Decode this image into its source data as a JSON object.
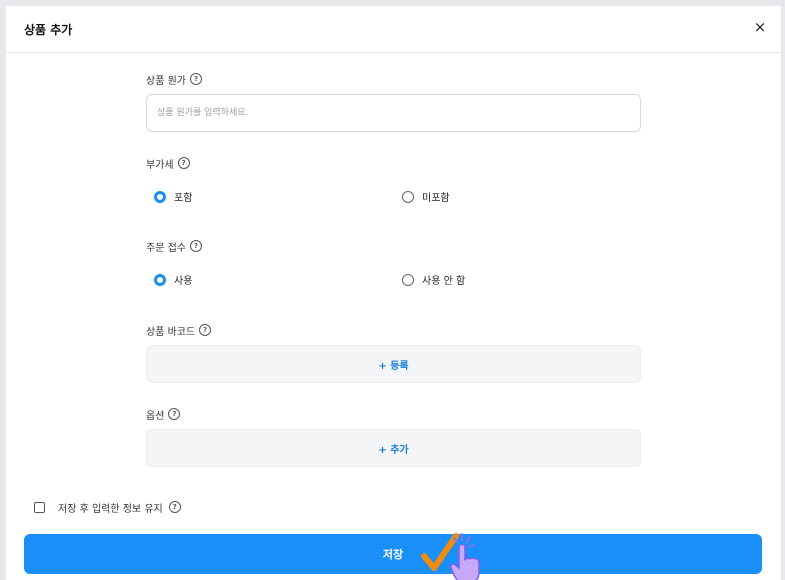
{
  "modal": {
    "title": "상품 추가",
    "close_label": "×"
  },
  "fields": {
    "cost": {
      "label": "상품 원가",
      "placeholder": "상품 원가를 입력하세요.",
      "value": ""
    },
    "vat": {
      "label": "부가세",
      "options": [
        "포함",
        "미포함"
      ],
      "selected": "포함"
    },
    "order_accept": {
      "label": "주문 접수",
      "options": [
        "사용",
        "사용 안 함"
      ],
      "selected": "사용"
    },
    "barcode": {
      "label": "상품 바코드",
      "button_label": "+ 등록"
    },
    "options": {
      "label": "옵션",
      "button_label": "+ 추가"
    }
  },
  "footer": {
    "keep_info_label": "저장 후 입력한 정보 유지",
    "keep_info_checked": false,
    "save_label": "저장"
  },
  "icons": {
    "help": "question-circle-icon",
    "click_indicator": "hand-pointer-check-icon"
  },
  "colors": {
    "accent": "#1a8ff8",
    "link": "#1a7fd9",
    "overlay_check": "#f28c0f",
    "overlay_hand": "#b38cf5"
  }
}
